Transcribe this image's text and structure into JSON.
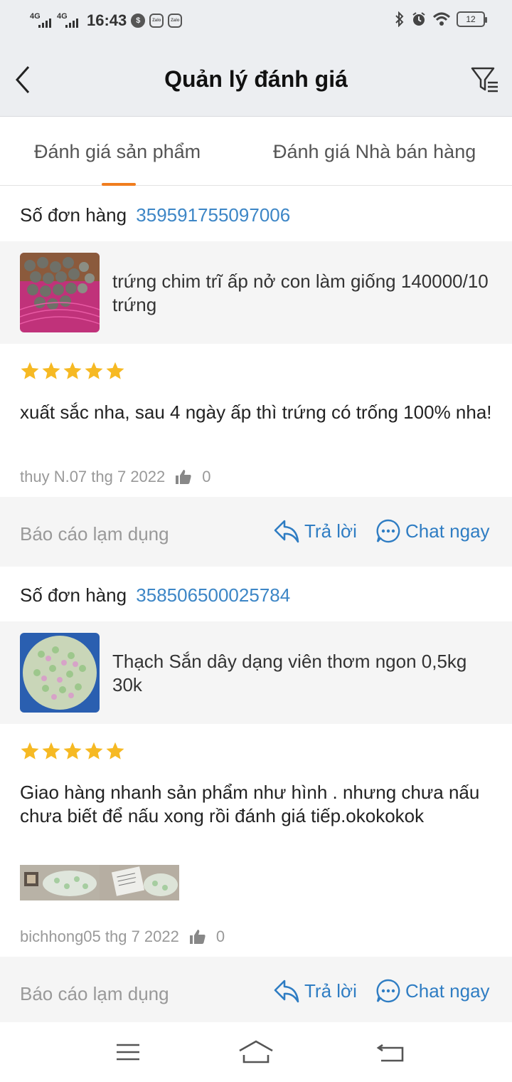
{
  "status_bar": {
    "network_1": "4G",
    "network_2": "4G",
    "time": "16:43",
    "app_icon_1": "Zalo",
    "app_icon_2": "Zalo",
    "battery": "12"
  },
  "header": {
    "title": "Quản lý đánh giá"
  },
  "tabs": [
    {
      "label": "Đánh giá sản phẩm",
      "active": true
    },
    {
      "label": "Đánh giá Nhà bán hàng",
      "active": false
    }
  ],
  "reviews": [
    {
      "order_label": "Số đơn hàng",
      "order_number": "359591755097006",
      "product_name": "trứng chim trĩ ấp nở con làm giống 140000/10 trứng",
      "rating": 5,
      "comment": "xuất sắc nha, sau 4 ngày ấp thì trứng có trống 100% nha!",
      "meta": "thuy N.07 thg 7 2022",
      "likes": "0",
      "report_label": "Báo cáo lạm dụng",
      "reply_label": "Trả lời",
      "chat_label": "Chat ngay"
    },
    {
      "order_label": "Số đơn hàng",
      "order_number": "358506500025784",
      "product_name": "Thạch Sắn dây dạng viên  thơm ngon 0,5kg 30k",
      "rating": 5,
      "comment": "Giao hàng nhanh sản phẩm như hình . nhưng chưa nấu chưa biết để nấu xong rồi đánh giá tiếp.okokokok",
      "meta": "bichhong05 thg 7 2022",
      "likes": "0",
      "report_label": "Báo cáo lạm dụng",
      "reply_label": "Trả lời",
      "chat_label": "Chat ngay"
    }
  ],
  "colors": {
    "accent": "#f07d1e",
    "link": "#3d86c6",
    "star": "#f6b923",
    "header_bg": "#eceef1",
    "card_bg": "#f5f5f5"
  },
  "icons": [
    "back-arrow-icon",
    "filter-icon",
    "star-icon",
    "thumbs-up-icon",
    "reply-icon",
    "chat-bubble-icon",
    "menu-icon",
    "home-icon",
    "back-icon"
  ]
}
